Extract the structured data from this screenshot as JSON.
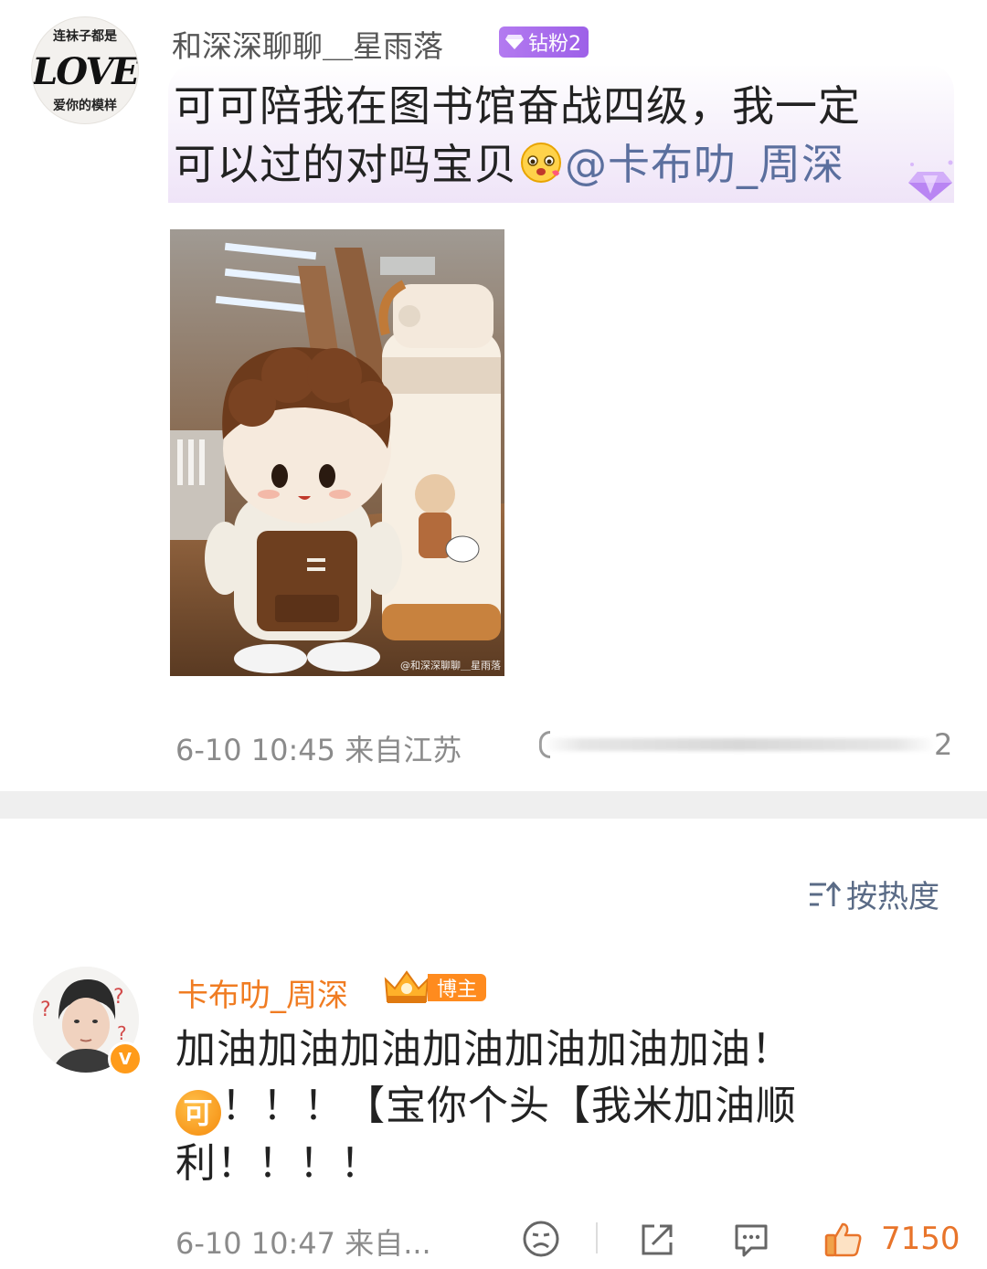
{
  "post": {
    "avatar_text": {
      "top": "连袜子都是",
      "middle": "LOVE",
      "bottom": "爱你的模样"
    },
    "username": "和深深聊聊＿星雨落",
    "fan_badge": "钻粉2",
    "text_line1": "可可陪我在图书馆奋战四级，我一定",
    "text_line2": "可以过的对吗宝贝",
    "mention": "@卡布叻_周深",
    "photo_watermark": "@和深深聊聊＿星雨落",
    "time_location": "6-10 10:45  来自江苏",
    "likes_count": "2"
  },
  "sort": {
    "label": "按热度"
  },
  "comment": {
    "username": "卡布叻_周深",
    "host_badge": "博主",
    "text_line1": "加油加油加油加油加油加油加油！",
    "emoji_label": "可",
    "text_line2_rest": "！！！【宝你个头【我米加油顺",
    "text_line3": "利！！！！",
    "time_location": "6-10 10:47  来自...",
    "like_count": "7150"
  },
  "colors": {
    "username_orange": "#f07c22",
    "mention_blue": "#5b6f9e",
    "badge_purple": "#a56cec",
    "like_orange": "#e8742a"
  },
  "icons": [
    "diamond-icon",
    "sort-icon",
    "dislike-face-icon",
    "share-icon",
    "comment-icon",
    "thumbs-up-icon",
    "verified-icon",
    "crown-icon"
  ]
}
